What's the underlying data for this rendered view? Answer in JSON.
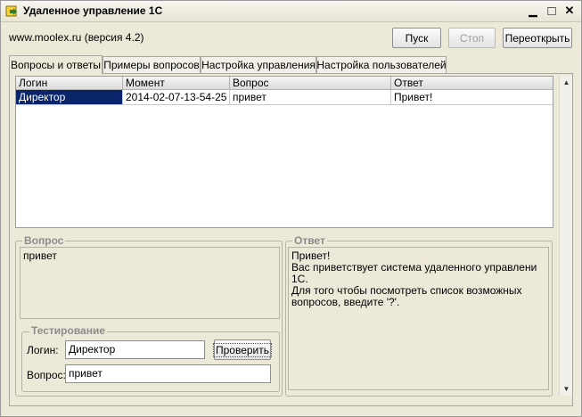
{
  "window": {
    "title": "Удаленное управление 1С",
    "minimize_glyph": "▁",
    "maximize_glyph": "□",
    "close_glyph": "✕"
  },
  "header": {
    "site": "www.moolex.ru (версия 4.2)",
    "start_label": "Пуск",
    "stop_label": "Стоп",
    "reopen_label": "Переоткрыть"
  },
  "tabs": [
    {
      "label": "Вопросы и ответы",
      "active": true
    },
    {
      "label": "Примеры вопросов",
      "active": false
    },
    {
      "label": "Настройка управления",
      "active": false
    },
    {
      "label": "Настройка пользователей",
      "active": false
    }
  ],
  "table": {
    "columns": [
      "Логин",
      "Момент",
      "Вопрос",
      "Ответ"
    ],
    "rows": [
      [
        "Директор",
        "2014-02-07-13-54-25",
        "привет",
        "Привет!"
      ]
    ]
  },
  "question_box": {
    "legend": "Вопрос",
    "text": "привет"
  },
  "answer_box": {
    "legend": "Ответ",
    "text": "Привет!\nВас приветствует система удаленного управлени 1С.\nДля того чтобы посмотреть список возможных\nвопросов, введите '?'."
  },
  "testing": {
    "legend": "Тестирование",
    "login_label": "Логин:",
    "login_value": "Директор",
    "check_label": "Проверить",
    "question_label": "Вопрос:",
    "question_value": "привет"
  },
  "icons": {
    "app": "app-icon",
    "scroll_up": "▲",
    "scroll_down": "▼"
  }
}
